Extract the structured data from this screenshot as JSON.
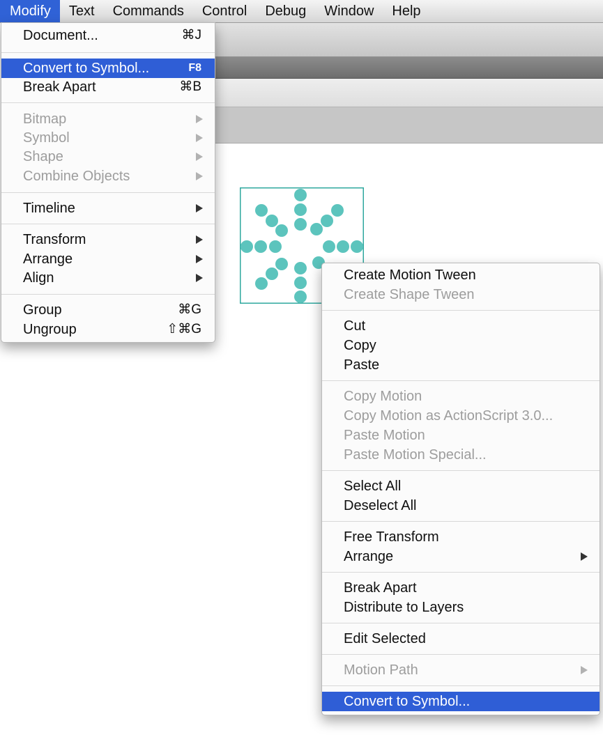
{
  "menubar": {
    "items": [
      "Modify",
      "Text",
      "Commands",
      "Control",
      "Debug",
      "Window",
      "Help"
    ]
  },
  "modify_menu": {
    "document": {
      "label": "Document...",
      "shortcut": "⌘J"
    },
    "convert": {
      "label": "Convert to Symbol...",
      "shortcut": "F8"
    },
    "break_apart": {
      "label": "Break Apart",
      "shortcut": "⌘B"
    },
    "bitmap": {
      "label": "Bitmap"
    },
    "symbol": {
      "label": "Symbol"
    },
    "shape": {
      "label": "Shape"
    },
    "combine": {
      "label": "Combine Objects"
    },
    "timeline": {
      "label": "Timeline"
    },
    "transform": {
      "label": "Transform"
    },
    "arrange": {
      "label": "Arrange"
    },
    "align": {
      "label": "Align"
    },
    "group": {
      "label": "Group",
      "shortcut": "⌘G"
    },
    "ungroup": {
      "label": "Ungroup",
      "shortcut": "⇧⌘G"
    }
  },
  "context_menu": {
    "create_motion_tween": "Create Motion Tween",
    "create_shape_tween": "Create Shape Tween",
    "cut": "Cut",
    "copy": "Copy",
    "paste": "Paste",
    "copy_motion": "Copy Motion",
    "copy_motion_as3": "Copy Motion as ActionScript 3.0...",
    "paste_motion": "Paste Motion",
    "paste_motion_special": "Paste Motion Special...",
    "select_all": "Select All",
    "deselect_all": "Deselect All",
    "free_transform": "Free Transform",
    "arrange": "Arrange",
    "break_apart": "Break Apart",
    "distribute_to_layers": "Distribute to Layers",
    "edit_selected": "Edit Selected",
    "motion_path": "Motion Path",
    "convert_to_symbol": "Convert to Symbol..."
  },
  "colors": {
    "highlight": "#2f5ed6",
    "dot": "#5cc4bd",
    "selection": "#2fa89f"
  }
}
